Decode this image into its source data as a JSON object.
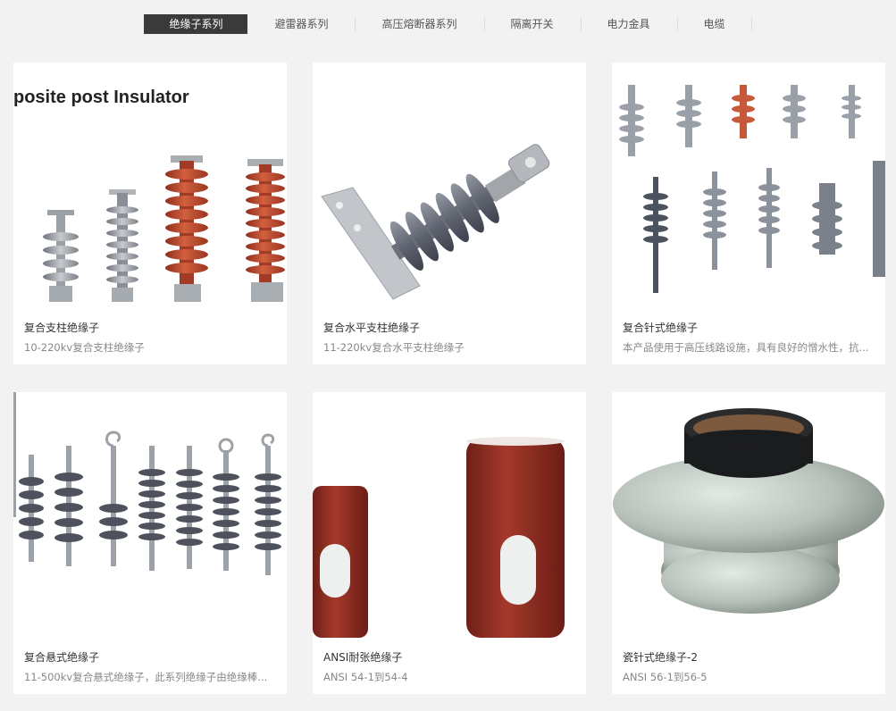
{
  "tabs": [
    {
      "label": "绝缘子系列",
      "active": true
    },
    {
      "label": "避雷器系列",
      "active": false
    },
    {
      "label": "高压熔断器系列",
      "active": false
    },
    {
      "label": "隔离开关",
      "active": false
    },
    {
      "label": "电力金具",
      "active": false
    },
    {
      "label": "电缆",
      "active": false
    }
  ],
  "products": [
    {
      "title": "复合支柱绝缘子",
      "desc": "10-220kv复合支柱绝缘子",
      "image_text": "posite post Insulator",
      "image": "composite-post-insulators"
    },
    {
      "title": "复合水平支柱绝缘子",
      "desc": "11-220kv复合水平支柱绝缘子",
      "image": "horizontal-post-insulator"
    },
    {
      "title": "复合针式绝缘子",
      "desc": "本产品使用于高压线路设施，具有良好的憎水性，抗...",
      "image": "composite-pin-insulators"
    },
    {
      "title": "复合悬式绝缘子",
      "desc": "11-500kv复合悬式绝缘子，此系列绝缘子由绝缘棒...",
      "image": "suspension-insulators"
    },
    {
      "title": "ANSI耐张绝缘子",
      "desc": "ANSI 54-1到54-4",
      "image": "ansi-strain-insulators"
    },
    {
      "title": "瓷针式绝缘子-2",
      "desc": "ANSI 56-1到56-5",
      "image": "porcelain-pin-insulator"
    }
  ],
  "colors": {
    "active_tab_bg": "#3a3a3a",
    "insulator_red": "#b5462c",
    "insulator_grey": "#8a8f96",
    "porcelain_brown": "#8e2f24",
    "porcelain_grey": "#b9c2bb"
  }
}
